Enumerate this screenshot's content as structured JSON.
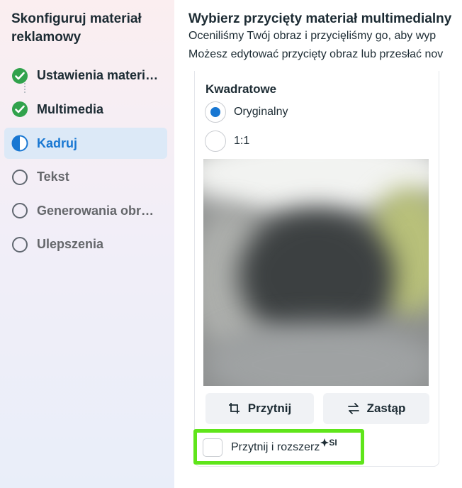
{
  "sidebar": {
    "title": "Skonfiguruj materiał reklamowy",
    "steps": [
      {
        "label": "Ustawienia materiału reklamowego",
        "status": "done",
        "icon": "check-circle-icon"
      },
      {
        "label": "Multimedia",
        "status": "done",
        "icon": "check-circle-icon"
      },
      {
        "label": "Kadruj",
        "status": "current",
        "icon": "half-circle-icon"
      },
      {
        "label": "Tekst",
        "status": "todo",
        "icon": "empty-circle-icon"
      },
      {
        "label": "Generowania obrazów",
        "status": "todo",
        "icon": "empty-circle-icon"
      },
      {
        "label": "Ulepszenia",
        "status": "todo",
        "icon": "empty-circle-icon"
      }
    ]
  },
  "main": {
    "heading": "Wybierz przycięty materiał multimedialny",
    "line1": "Oceniliśmy Twój obraz i przycięliśmy go, aby wyp",
    "line2": "Możesz edytować przycięty obraz lub przesłać nov",
    "card": {
      "title": "Kwadratowe",
      "options": [
        {
          "label": "Oryginalny",
          "selected": true
        },
        {
          "label": "1:1",
          "selected": false
        }
      ],
      "crop_button": "Przytnij",
      "replace_button": "Zastąp",
      "expand_checkbox": {
        "label": "Przytnij i rozszerz",
        "checked": false,
        "badge": "SI"
      }
    }
  },
  "colors": {
    "accent": "#1877d2",
    "done_green": "#31a24c",
    "highlight": "#5fe51a"
  }
}
